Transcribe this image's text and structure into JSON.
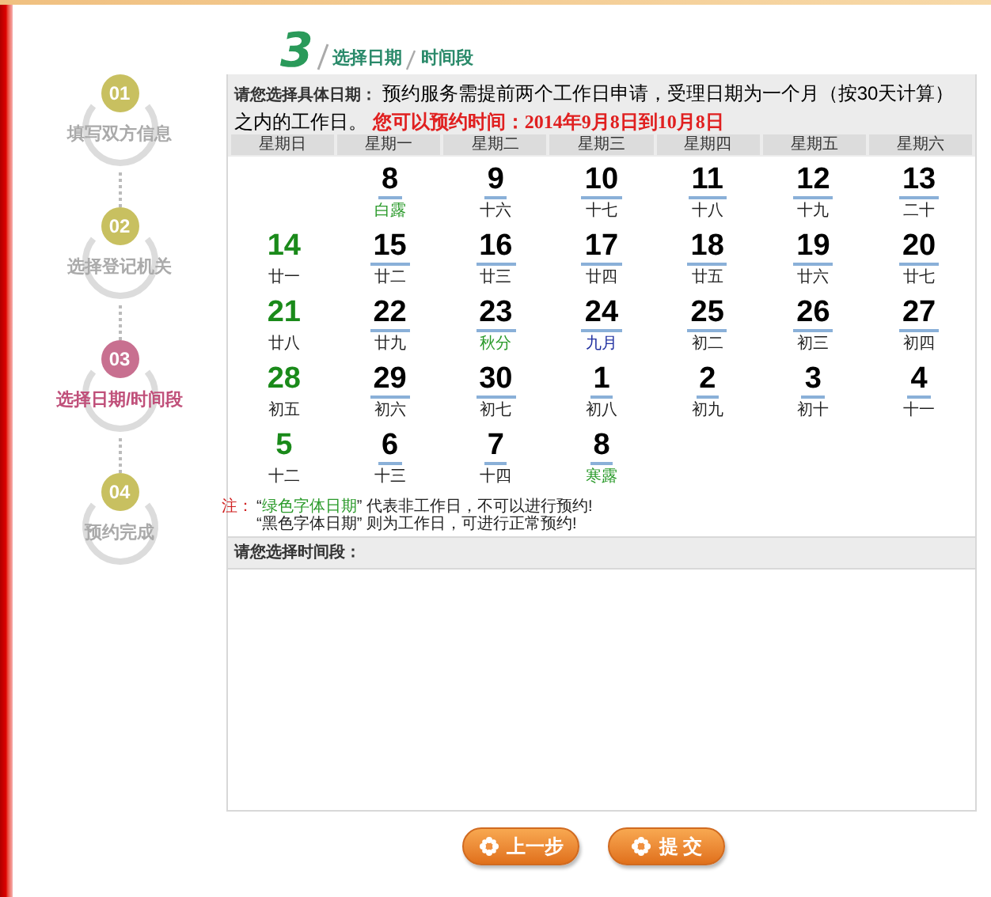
{
  "steps": [
    {
      "number": "01",
      "label": "填写双方信息",
      "selected": false
    },
    {
      "number": "02",
      "label": "选择登记机关",
      "selected": false
    },
    {
      "number": "03",
      "label": "选择日期/时间段",
      "selected": true
    },
    {
      "number": "04",
      "label": "预约完成",
      "selected": false
    }
  ],
  "panel": {
    "step_number": "3",
    "title": "选择日期",
    "subtitle": "时间段"
  },
  "intro": {
    "label": "请您选择具体日期：",
    "text": "预约服务需提前两个工作日申请，受理日期为一个月（按30天计算）之内的工作日。",
    "highlight": "您可以预约时间：2014年9月8日到10月8日"
  },
  "weekdays": [
    "星期日",
    "星期一",
    "星期二",
    "星期三",
    "星期四",
    "星期五",
    "星期六"
  ],
  "days": [
    {
      "day": "8",
      "lunar": "白露",
      "workday": true,
      "color": "#2a9a2a"
    },
    {
      "day": "9",
      "lunar": "十六",
      "workday": true,
      "color": "#222222"
    },
    {
      "day": "10",
      "lunar": "十七",
      "workday": true,
      "color": "#222222"
    },
    {
      "day": "11",
      "lunar": "十八",
      "workday": true,
      "color": "#222222"
    },
    {
      "day": "12",
      "lunar": "十九",
      "workday": true,
      "color": "#222222"
    },
    {
      "day": "13",
      "lunar": "二十",
      "workday": true,
      "color": "#222222"
    },
    {
      "day": "14",
      "lunar": "廿一",
      "workday": false,
      "color": "#222222"
    },
    {
      "day": "15",
      "lunar": "廿二",
      "workday": true,
      "color": "#222222"
    },
    {
      "day": "16",
      "lunar": "廿三",
      "workday": true,
      "color": "#222222"
    },
    {
      "day": "17",
      "lunar": "廿四",
      "workday": true,
      "color": "#222222"
    },
    {
      "day": "18",
      "lunar": "廿五",
      "workday": true,
      "color": "#222222"
    },
    {
      "day": "19",
      "lunar": "廿六",
      "workday": true,
      "color": "#222222"
    },
    {
      "day": "20",
      "lunar": "廿七",
      "workday": true,
      "color": "#222222"
    },
    {
      "day": "21",
      "lunar": "廿八",
      "workday": false,
      "color": "#222222"
    },
    {
      "day": "22",
      "lunar": "廿九",
      "workday": true,
      "color": "#222222"
    },
    {
      "day": "23",
      "lunar": "秋分",
      "workday": true,
      "color": "#2a9a2a"
    },
    {
      "day": "24",
      "lunar": "九月",
      "workday": true,
      "color": "#2030a0"
    },
    {
      "day": "25",
      "lunar": "初二",
      "workday": true,
      "color": "#222222"
    },
    {
      "day": "26",
      "lunar": "初三",
      "workday": true,
      "color": "#222222"
    },
    {
      "day": "27",
      "lunar": "初四",
      "workday": true,
      "color": "#222222"
    },
    {
      "day": "28",
      "lunar": "初五",
      "workday": false,
      "color": "#222222"
    },
    {
      "day": "29",
      "lunar": "初六",
      "workday": true,
      "color": "#222222"
    },
    {
      "day": "30",
      "lunar": "初七",
      "workday": true,
      "color": "#222222"
    },
    {
      "day": "1",
      "lunar": "初八",
      "workday": true,
      "color": "#222222"
    },
    {
      "day": "2",
      "lunar": "初九",
      "workday": true,
      "color": "#222222"
    },
    {
      "day": "3",
      "lunar": "初十",
      "workday": true,
      "color": "#222222"
    },
    {
      "day": "4",
      "lunar": "十一",
      "workday": true,
      "color": "#222222"
    },
    {
      "day": "5",
      "lunar": "十二",
      "workday": false,
      "color": "#222222"
    },
    {
      "day": "6",
      "lunar": "十三",
      "workday": true,
      "color": "#222222"
    },
    {
      "day": "7",
      "lunar": "十四",
      "workday": true,
      "color": "#222222"
    },
    {
      "day": "8",
      "lunar": "寒露",
      "workday": true,
      "color": "#2a9a2a"
    }
  ],
  "note": {
    "label": "注：",
    "lines": [
      {
        "before": "“",
        "highlight": "绿色字体日期",
        "after": "” 代表非工作日，不可以进行预约!"
      },
      {
        "before": "“黑色字体日期” 则为工作日，可进行正常预约!"
      }
    ]
  },
  "time_section": {
    "title": "请您选择时间段："
  },
  "buttons": [
    "上一步",
    "提 交"
  ]
}
